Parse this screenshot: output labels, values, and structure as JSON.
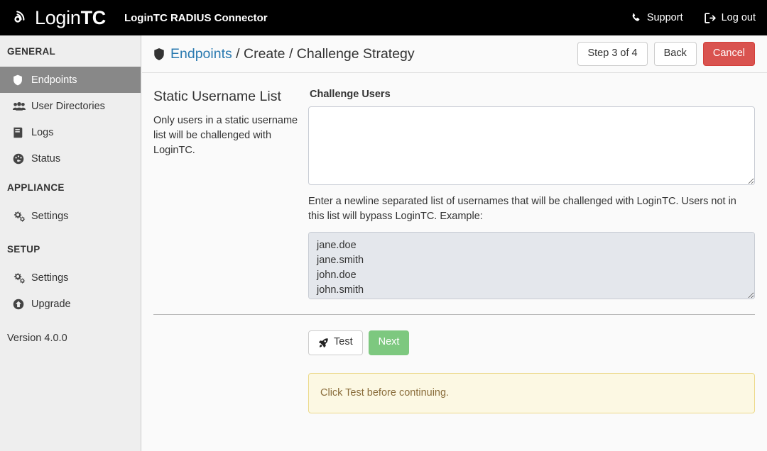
{
  "navbar": {
    "brand_light": "Login",
    "brand_bold": "TC",
    "brand_icon": "signal-circle-icon",
    "title": "LoginTC RADIUS Connector",
    "links": [
      {
        "label": "Support",
        "icon": "phone-icon"
      },
      {
        "label": "Log out",
        "icon": "sign-out-icon"
      }
    ]
  },
  "sidebar": {
    "groups": [
      {
        "heading": "GENERAL",
        "items": [
          {
            "label": "Endpoints",
            "icon": "shield-icon",
            "active": true
          },
          {
            "label": "User Directories",
            "icon": "users-icon",
            "active": false
          },
          {
            "label": "Logs",
            "icon": "book-icon",
            "active": false
          },
          {
            "label": "Status",
            "icon": "tachometer-icon",
            "active": false
          }
        ]
      },
      {
        "heading": "APPLIANCE",
        "items": [
          {
            "label": "Settings",
            "icon": "cogs-icon",
            "active": false
          }
        ]
      },
      {
        "heading": "SETUP",
        "items": [
          {
            "label": "Settings",
            "icon": "cogs-icon",
            "active": false
          },
          {
            "label": "Upgrade",
            "icon": "arrow-circle-up-icon",
            "active": false
          }
        ]
      }
    ],
    "version": "Version 4.0.0"
  },
  "page": {
    "breadcrumb": {
      "icon": "shield-icon",
      "link": "Endpoints",
      "sep1": " / ",
      "part2": "Create",
      "sep2": " / ",
      "part3": "Challenge Strategy"
    },
    "header_buttons": {
      "step": "Step 3 of 4",
      "back": "Back",
      "cancel": "Cancel"
    },
    "section": {
      "title": "Static Username List",
      "description": "Only users in a static username list will be challenged with LoginTC."
    },
    "challenge_users": {
      "label": "Challenge Users",
      "value": "",
      "placeholder": ""
    },
    "help_text": "Enter a newline separated list of usernames that will be challenged with LoginTC. Users not in this list will bypass LoginTC. Example:",
    "example_users": "jane.doe\njane.smith\njohn.doe\njohn.smith",
    "actions": {
      "test": "Test",
      "test_icon": "rocket-icon",
      "next": "Next"
    },
    "alert": {
      "message": "Click Test before continuing.",
      "color": "#8a6d3b",
      "background": "#fcf8e3",
      "border": "#ecd98a"
    }
  },
  "colors": {
    "navbar_bg": "#000000",
    "sidebar_bg": "#eeeeee",
    "active_item_bg": "#888888",
    "content_bg": "#fafafa",
    "link_blue": "#2a7ab0",
    "danger_red": "#d9534f",
    "success_green": "#7dc87f"
  }
}
